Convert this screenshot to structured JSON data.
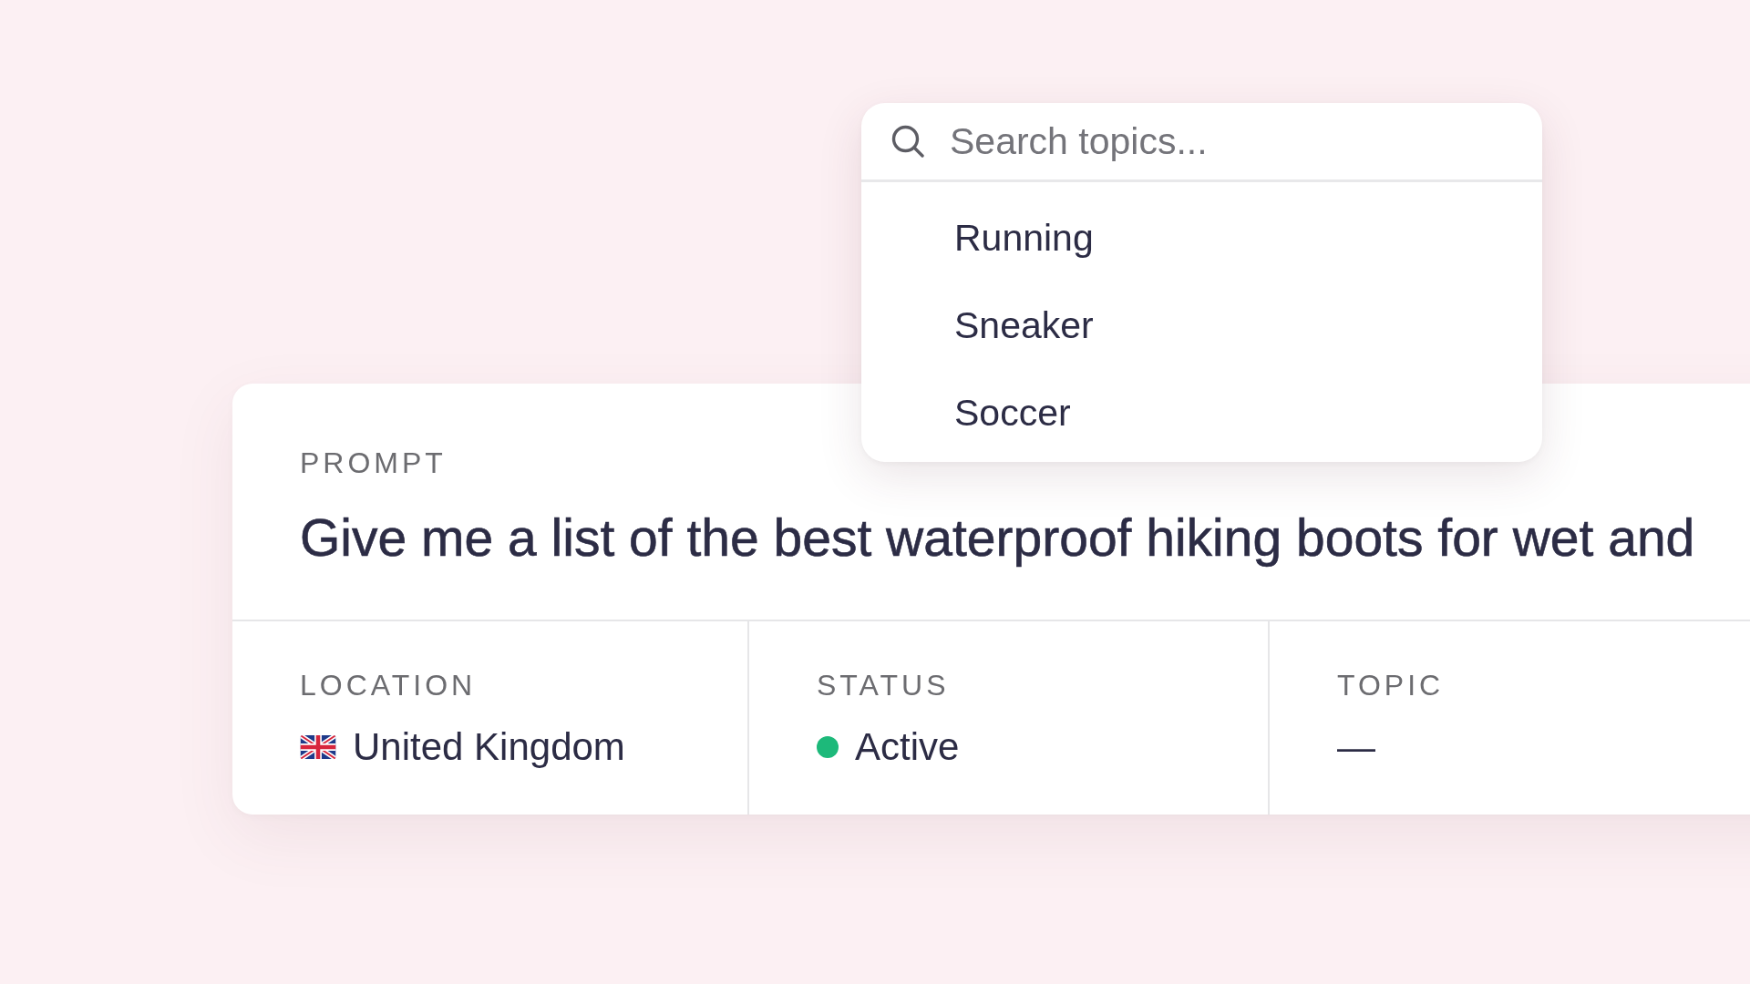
{
  "search": {
    "placeholder": "Search topics...",
    "options": [
      {
        "label": "Running",
        "selected": false
      },
      {
        "label": "Sneaker",
        "selected": false
      },
      {
        "label": "Soccer",
        "selected": false
      }
    ]
  },
  "prompt": {
    "label": "PROMPT",
    "text": "Give me a list of the best waterproof hiking boots for wet and"
  },
  "fields": [
    {
      "kind": "location",
      "label": "LOCATION",
      "value": "United Kingdom"
    },
    {
      "kind": "status",
      "label": "STATUS",
      "value": "Active",
      "color": "#1db97a"
    },
    {
      "kind": "topic",
      "label": "TOPIC",
      "value": "—"
    }
  ]
}
